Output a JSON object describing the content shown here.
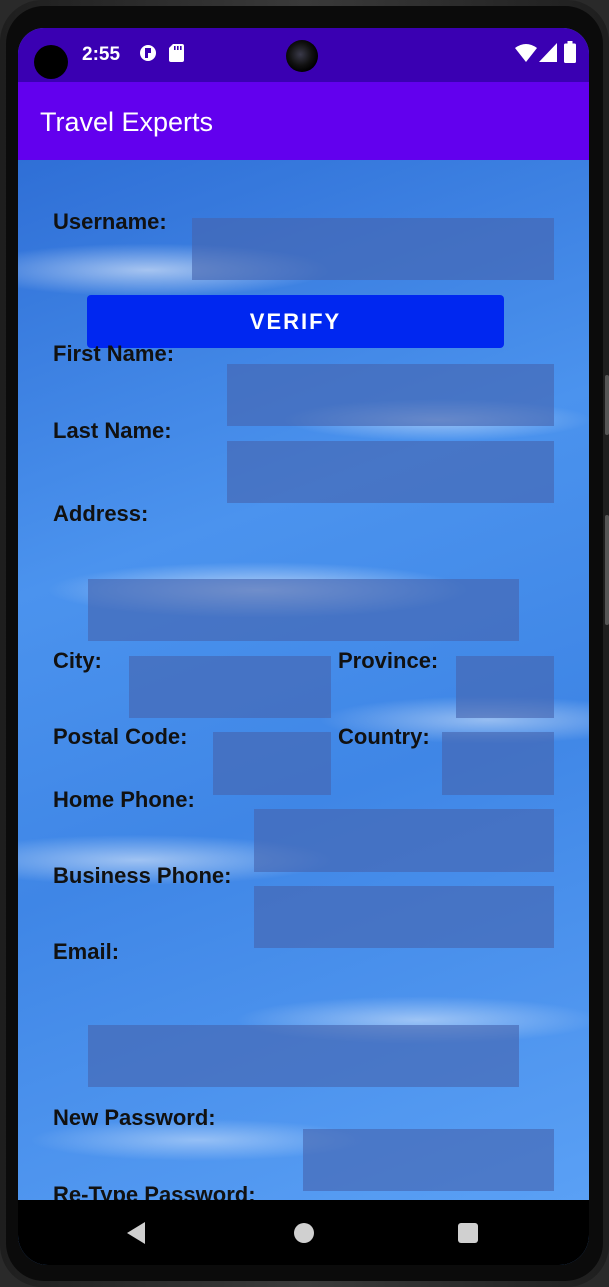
{
  "status_bar": {
    "time": "2:55",
    "icons": [
      "notification-icon",
      "sd-card-icon",
      "wifi-icon",
      "signal-icon",
      "battery-icon"
    ]
  },
  "app_bar": {
    "title": "Travel Experts"
  },
  "form": {
    "username_label": "Username:",
    "verify_label": "VERIFY",
    "first_name_label": "First Name:",
    "last_name_label": "Last Name:",
    "address_label": "Address:",
    "city_label": "City:",
    "province_label": "Province:",
    "postal_code_label": "Postal Code:",
    "country_label": "Country:",
    "home_phone_label": "Home Phone:",
    "business_phone_label": "Business Phone:",
    "email_label": "Email:",
    "new_password_label": "New Password:",
    "retype_password_label": "Re-Type Password:"
  },
  "nav_bar": {
    "icons": [
      "back-icon",
      "home-icon",
      "recents-icon"
    ]
  },
  "colors": {
    "status_bar": "#3a00b2",
    "app_bar": "#6200ee",
    "verify_button": "#0027f0"
  }
}
